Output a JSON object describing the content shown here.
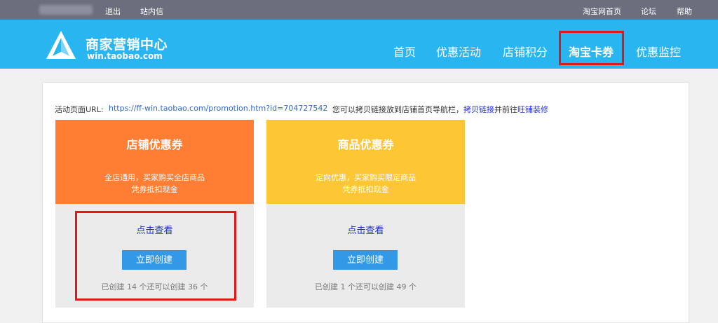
{
  "topbar": {
    "logout": "退出",
    "inbox": "站内信",
    "taobao_home": "淘宝网首页",
    "forum": "论坛",
    "help": "帮助"
  },
  "header": {
    "brand_title": "商家营销中心",
    "brand_url": "win.taobao.com",
    "nav": [
      "首页",
      "优惠活动",
      "店铺积分",
      "淘宝卡券",
      "优惠监控"
    ],
    "active_nav": "淘宝卡券"
  },
  "urlrow": {
    "label": "活动页面URL:",
    "url": "https://ff-win.taobao.com/promotion.htm?id=704727542",
    "tip_prefix": "您可以拷贝链接放到店铺首页导航栏，",
    "copy_link": "拷贝链接",
    "tip_mid": "并前往",
    "wangpu": "旺铺装修"
  },
  "cards": [
    {
      "title": "店铺优惠券",
      "desc1": "全店通用，买家购买全店商品",
      "desc2": "凭券抵扣现金",
      "view": "点击查看",
      "create": "立即创建",
      "count": "已创建 14 个还可以创建 36 个",
      "color": "#ff7e33"
    },
    {
      "title": "商品优惠券",
      "desc1": "定向优惠，买家购买限定商品",
      "desc2": "凭券抵扣现金",
      "view": "点击查看",
      "create": "立即创建",
      "count": "已创建 1 个还可以创建 49 个",
      "color": "#fdc635"
    }
  ],
  "colors": {
    "topbar": "#6b6e7c",
    "header": "#29b6f0",
    "highlight": "#e01818",
    "button": "#3399e6"
  }
}
